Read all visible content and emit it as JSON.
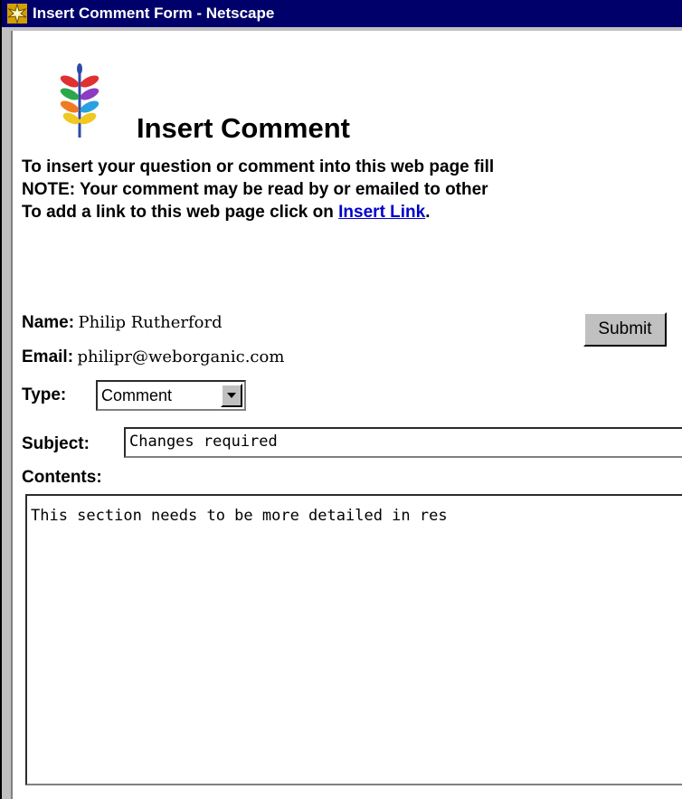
{
  "window": {
    "title": "Insert Comment Form - Netscape"
  },
  "page": {
    "title": "Insert Comment",
    "intro_line1": "To insert your question or comment into this web page fill",
    "intro_line2": "NOTE: Your comment may be read by or emailed to other",
    "intro_line3_prefix": "To add a link to this web page click on ",
    "intro_link": "Insert Link",
    "intro_line3_suffix": "."
  },
  "form": {
    "name_label": "Name:",
    "name_value": "Philip Rutherford",
    "email_label": "Email:",
    "email_value": "philipr@weborganic.com",
    "type_label": "Type:",
    "type_value": "Comment",
    "subject_label": "Subject:",
    "subject_value": "Changes required",
    "contents_label": "Contents:",
    "contents_value": "This section needs to be more detailed in res",
    "submit_label": "Submit"
  },
  "icons": {
    "app": "netscape-icon",
    "logo": "plant-logo",
    "dropdown": "chevron-down-icon"
  },
  "colors": {
    "titlebar": "#00006b",
    "link": "#0000cc",
    "chrome": "#c0c0c0"
  }
}
